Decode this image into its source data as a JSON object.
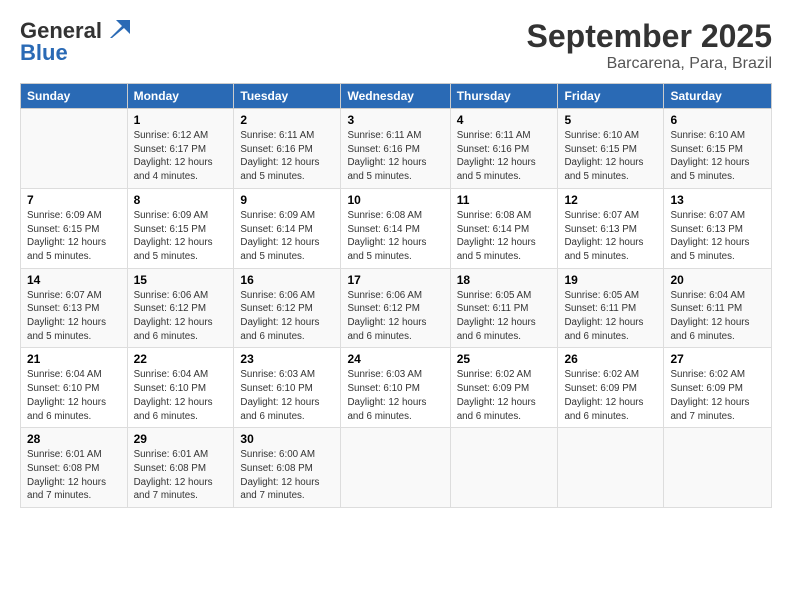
{
  "logo": {
    "line1": "General",
    "line2": "Blue"
  },
  "title": "September 2025",
  "subtitle": "Barcarena, Para, Brazil",
  "days_of_week": [
    "Sunday",
    "Monday",
    "Tuesday",
    "Wednesday",
    "Thursday",
    "Friday",
    "Saturday"
  ],
  "weeks": [
    [
      {
        "num": "",
        "sunrise": "",
        "sunset": "",
        "daylight": ""
      },
      {
        "num": "1",
        "sunrise": "Sunrise: 6:12 AM",
        "sunset": "Sunset: 6:17 PM",
        "daylight": "Daylight: 12 hours and 4 minutes."
      },
      {
        "num": "2",
        "sunrise": "Sunrise: 6:11 AM",
        "sunset": "Sunset: 6:16 PM",
        "daylight": "Daylight: 12 hours and 5 minutes."
      },
      {
        "num": "3",
        "sunrise": "Sunrise: 6:11 AM",
        "sunset": "Sunset: 6:16 PM",
        "daylight": "Daylight: 12 hours and 5 minutes."
      },
      {
        "num": "4",
        "sunrise": "Sunrise: 6:11 AM",
        "sunset": "Sunset: 6:16 PM",
        "daylight": "Daylight: 12 hours and 5 minutes."
      },
      {
        "num": "5",
        "sunrise": "Sunrise: 6:10 AM",
        "sunset": "Sunset: 6:15 PM",
        "daylight": "Daylight: 12 hours and 5 minutes."
      },
      {
        "num": "6",
        "sunrise": "Sunrise: 6:10 AM",
        "sunset": "Sunset: 6:15 PM",
        "daylight": "Daylight: 12 hours and 5 minutes."
      }
    ],
    [
      {
        "num": "7",
        "sunrise": "Sunrise: 6:09 AM",
        "sunset": "Sunset: 6:15 PM",
        "daylight": "Daylight: 12 hours and 5 minutes."
      },
      {
        "num": "8",
        "sunrise": "Sunrise: 6:09 AM",
        "sunset": "Sunset: 6:15 PM",
        "daylight": "Daylight: 12 hours and 5 minutes."
      },
      {
        "num": "9",
        "sunrise": "Sunrise: 6:09 AM",
        "sunset": "Sunset: 6:14 PM",
        "daylight": "Daylight: 12 hours and 5 minutes."
      },
      {
        "num": "10",
        "sunrise": "Sunrise: 6:08 AM",
        "sunset": "Sunset: 6:14 PM",
        "daylight": "Daylight: 12 hours and 5 minutes."
      },
      {
        "num": "11",
        "sunrise": "Sunrise: 6:08 AM",
        "sunset": "Sunset: 6:14 PM",
        "daylight": "Daylight: 12 hours and 5 minutes."
      },
      {
        "num": "12",
        "sunrise": "Sunrise: 6:07 AM",
        "sunset": "Sunset: 6:13 PM",
        "daylight": "Daylight: 12 hours and 5 minutes."
      },
      {
        "num": "13",
        "sunrise": "Sunrise: 6:07 AM",
        "sunset": "Sunset: 6:13 PM",
        "daylight": "Daylight: 12 hours and 5 minutes."
      }
    ],
    [
      {
        "num": "14",
        "sunrise": "Sunrise: 6:07 AM",
        "sunset": "Sunset: 6:13 PM",
        "daylight": "Daylight: 12 hours and 5 minutes."
      },
      {
        "num": "15",
        "sunrise": "Sunrise: 6:06 AM",
        "sunset": "Sunset: 6:12 PM",
        "daylight": "Daylight: 12 hours and 6 minutes."
      },
      {
        "num": "16",
        "sunrise": "Sunrise: 6:06 AM",
        "sunset": "Sunset: 6:12 PM",
        "daylight": "Daylight: 12 hours and 6 minutes."
      },
      {
        "num": "17",
        "sunrise": "Sunrise: 6:06 AM",
        "sunset": "Sunset: 6:12 PM",
        "daylight": "Daylight: 12 hours and 6 minutes."
      },
      {
        "num": "18",
        "sunrise": "Sunrise: 6:05 AM",
        "sunset": "Sunset: 6:11 PM",
        "daylight": "Daylight: 12 hours and 6 minutes."
      },
      {
        "num": "19",
        "sunrise": "Sunrise: 6:05 AM",
        "sunset": "Sunset: 6:11 PM",
        "daylight": "Daylight: 12 hours and 6 minutes."
      },
      {
        "num": "20",
        "sunrise": "Sunrise: 6:04 AM",
        "sunset": "Sunset: 6:11 PM",
        "daylight": "Daylight: 12 hours and 6 minutes."
      }
    ],
    [
      {
        "num": "21",
        "sunrise": "Sunrise: 6:04 AM",
        "sunset": "Sunset: 6:10 PM",
        "daylight": "Daylight: 12 hours and 6 minutes."
      },
      {
        "num": "22",
        "sunrise": "Sunrise: 6:04 AM",
        "sunset": "Sunset: 6:10 PM",
        "daylight": "Daylight: 12 hours and 6 minutes."
      },
      {
        "num": "23",
        "sunrise": "Sunrise: 6:03 AM",
        "sunset": "Sunset: 6:10 PM",
        "daylight": "Daylight: 12 hours and 6 minutes."
      },
      {
        "num": "24",
        "sunrise": "Sunrise: 6:03 AM",
        "sunset": "Sunset: 6:10 PM",
        "daylight": "Daylight: 12 hours and 6 minutes."
      },
      {
        "num": "25",
        "sunrise": "Sunrise: 6:02 AM",
        "sunset": "Sunset: 6:09 PM",
        "daylight": "Daylight: 12 hours and 6 minutes."
      },
      {
        "num": "26",
        "sunrise": "Sunrise: 6:02 AM",
        "sunset": "Sunset: 6:09 PM",
        "daylight": "Daylight: 12 hours and 6 minutes."
      },
      {
        "num": "27",
        "sunrise": "Sunrise: 6:02 AM",
        "sunset": "Sunset: 6:09 PM",
        "daylight": "Daylight: 12 hours and 7 minutes."
      }
    ],
    [
      {
        "num": "28",
        "sunrise": "Sunrise: 6:01 AM",
        "sunset": "Sunset: 6:08 PM",
        "daylight": "Daylight: 12 hours and 7 minutes."
      },
      {
        "num": "29",
        "sunrise": "Sunrise: 6:01 AM",
        "sunset": "Sunset: 6:08 PM",
        "daylight": "Daylight: 12 hours and 7 minutes."
      },
      {
        "num": "30",
        "sunrise": "Sunrise: 6:00 AM",
        "sunset": "Sunset: 6:08 PM",
        "daylight": "Daylight: 12 hours and 7 minutes."
      },
      {
        "num": "",
        "sunrise": "",
        "sunset": "",
        "daylight": ""
      },
      {
        "num": "",
        "sunrise": "",
        "sunset": "",
        "daylight": ""
      },
      {
        "num": "",
        "sunrise": "",
        "sunset": "",
        "daylight": ""
      },
      {
        "num": "",
        "sunrise": "",
        "sunset": "",
        "daylight": ""
      }
    ]
  ]
}
